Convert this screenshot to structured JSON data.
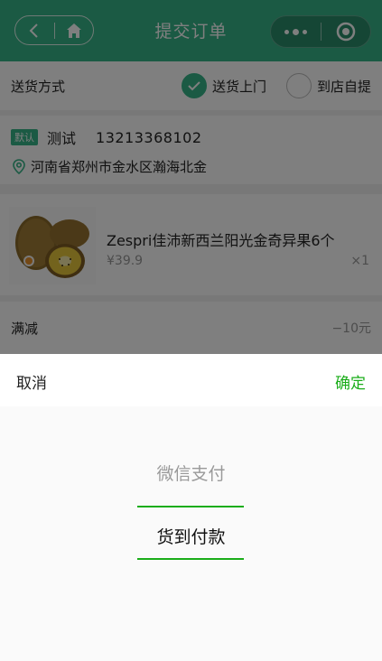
{
  "header": {
    "title": "提交订单"
  },
  "delivery": {
    "label": "送货方式",
    "options": [
      {
        "label": "送货上门",
        "checked": true
      },
      {
        "label": "到店自提",
        "checked": false
      }
    ]
  },
  "address": {
    "badge": "默认",
    "name": "测试",
    "phone": "13213368102",
    "detail": "河南省郑州市金水区瀚海北金"
  },
  "product": {
    "name": "Zespri佳沛新西兰阳光金奇异果6个",
    "price": "¥39.9",
    "quantity": "×1"
  },
  "discount": {
    "label": "满减",
    "value": "−10元"
  },
  "picker": {
    "cancel_label": "取消",
    "confirm_label": "确定",
    "options": [
      {
        "label": "微信支付"
      },
      {
        "label": "货到付款"
      }
    ],
    "selected_index": 1
  },
  "colors": {
    "brand": "#36b488",
    "confirm": "#1aad19"
  }
}
